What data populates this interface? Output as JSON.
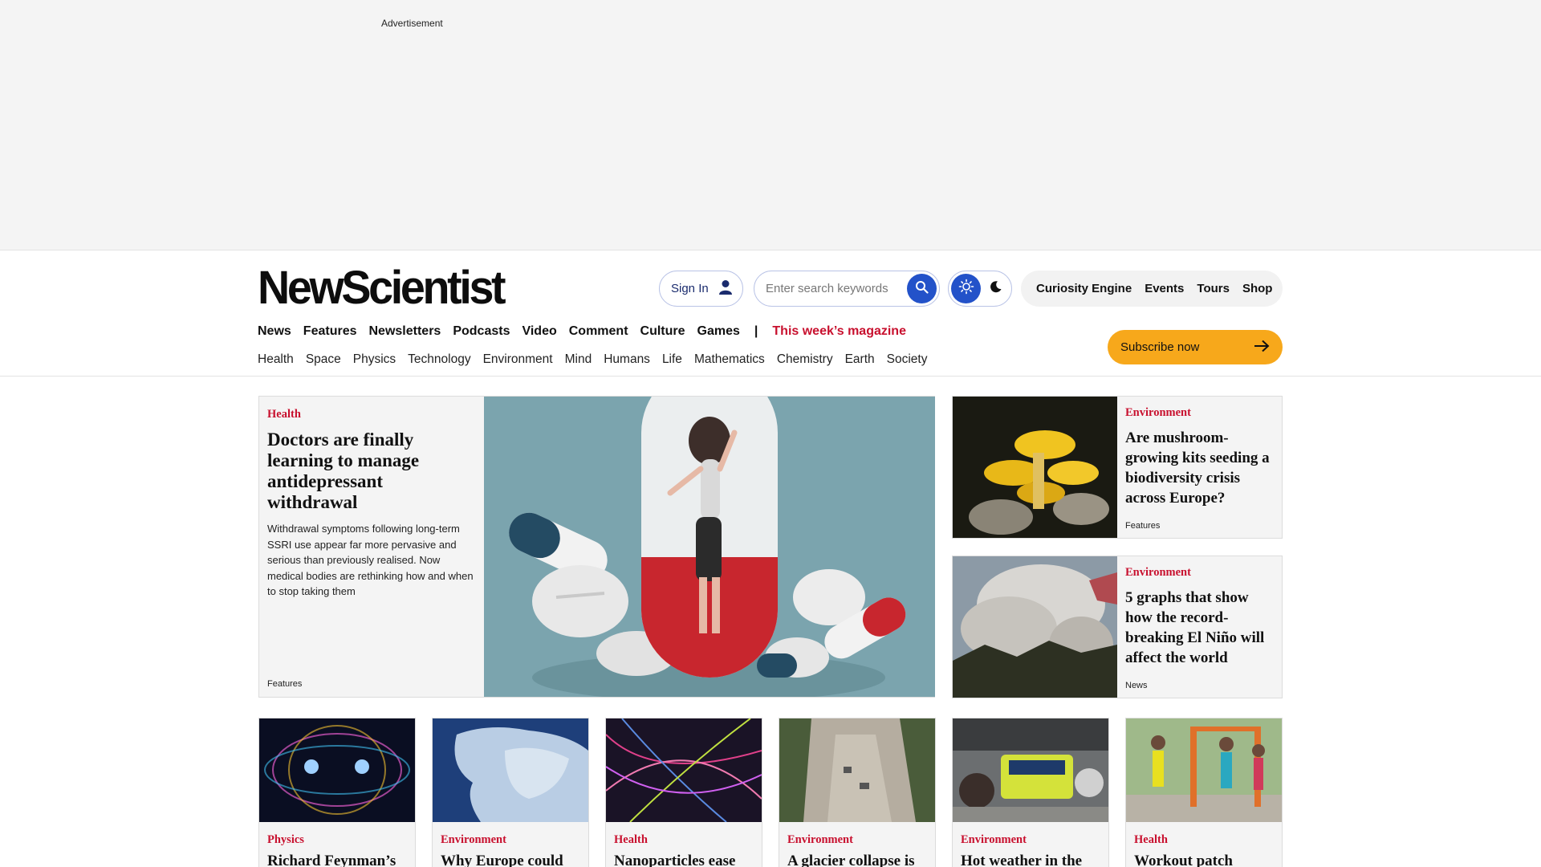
{
  "ad": {
    "label": "Advertisement"
  },
  "header": {
    "logo": "NewScientist",
    "signin_label": "Sign In",
    "search_placeholder": "Enter search keywords",
    "utility_links": [
      "Curiosity Engine",
      "Events",
      "Tours",
      "Shop"
    ],
    "subscribe_label": "Subscribe now"
  },
  "main_nav": {
    "items": [
      "News",
      "Features",
      "Newsletters",
      "Podcasts",
      "Video",
      "Comment",
      "Culture",
      "Games"
    ],
    "separator": "|",
    "magazine": "This week’s magazine"
  },
  "sub_nav": [
    "Health",
    "Space",
    "Physics",
    "Technology",
    "Environment",
    "Mind",
    "Humans",
    "Life",
    "Mathematics",
    "Chemistry",
    "Earth",
    "Society"
  ],
  "hero": {
    "category": "Health",
    "title": "Doctors are finally learning to manage antidepressant withdrawal",
    "description": "Withdrawal symptoms following long-term SSRI use appear far more pervasive and serious than previously realised. Now medical bodies are rethinking how and when to stop taking them",
    "type": "Features"
  },
  "side_cards": [
    {
      "category": "Environment",
      "title": "Are mushroom-growing kits seeding a biodiversity crisis across Europe?",
      "type": "Features"
    },
    {
      "category": "Environment",
      "title": "5 graphs that show how the record-breaking El Niño will affect the world",
      "type": "News"
    }
  ],
  "cards": [
    {
      "category": "Physics",
      "title": "Richard Feynman’s"
    },
    {
      "category": "Environment",
      "title": "Why Europe could"
    },
    {
      "category": "Health",
      "title": "Nanoparticles ease"
    },
    {
      "category": "Environment",
      "title": "A glacier collapse is"
    },
    {
      "category": "Environment",
      "title": "Hot weather in the"
    },
    {
      "category": "Health",
      "title": "Workout patch"
    }
  ],
  "colors": {
    "accent_red": "#c8102e",
    "accent_blue": "#2352c9",
    "subscribe_orange": "#f7a81b"
  }
}
